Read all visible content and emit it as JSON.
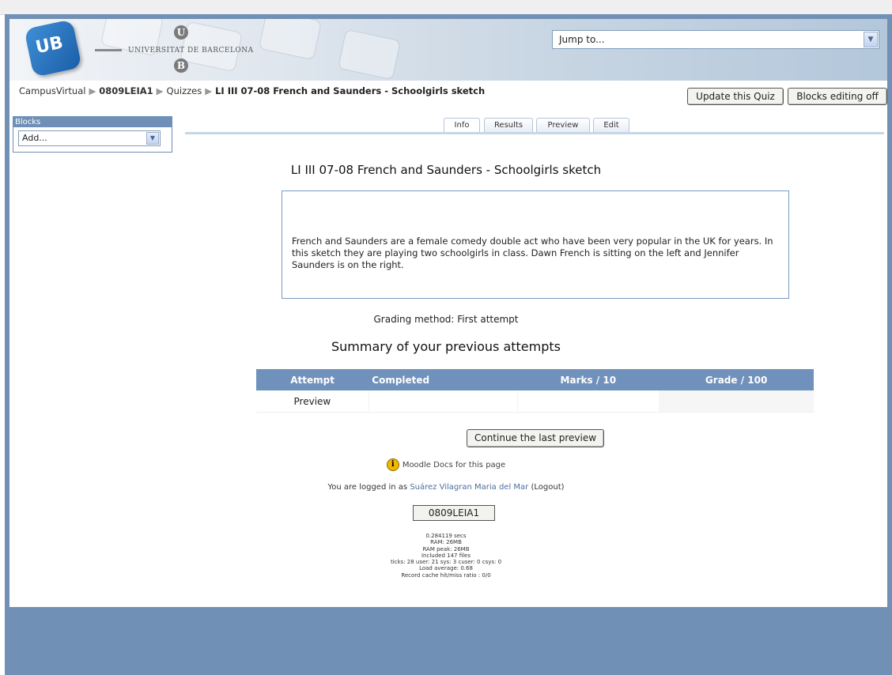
{
  "header": {
    "university": "UNIVERSITAT DE BARCELONA",
    "logo_text": "UB",
    "seal_u": "U",
    "seal_b": "B",
    "jump_label": "Jump to..."
  },
  "breadcrumb": {
    "home": "CampusVirtual",
    "course": "0809LEIA1",
    "section": "Quizzes",
    "current": "LI III 07-08 French and Saunders - Schoolgirls sketch"
  },
  "buttons": {
    "update": "Update this Quiz",
    "blocks_editing": "Blocks editing off",
    "continue": "Continue the last preview"
  },
  "blocks": {
    "header": "Blocks",
    "add_label": "Add..."
  },
  "tabs": [
    "Info",
    "Results",
    "Preview",
    "Edit"
  ],
  "quiz": {
    "title": "LI III 07-08 French and Saunders - Schoolgirls sketch",
    "intro": "French and Saunders are a female comedy double act who have been very popular in the UK for years. In this sketch they are playing two schoolgirls in class. Dawn French is sitting on the left and Jennifer Saunders is on the right.",
    "grading_method": "Grading method: First attempt",
    "summary_title": "Summary of your previous attempts"
  },
  "attempts_table": {
    "headers": [
      "Attempt",
      "Completed",
      "Marks / 10",
      "Grade / 100"
    ],
    "rows": [
      [
        "Preview",
        "",
        "",
        ""
      ]
    ]
  },
  "footer": {
    "docs_link": "Moodle Docs for this page",
    "logged_prefix": "You are logged in as",
    "user_name": "Suárez Vilagran Maria del Mar",
    "logout": "(Logout)",
    "course_button": "0809LEIA1",
    "perf_lines": [
      "0.284119 secs",
      "RAM: 26MB",
      "RAM peak: 26MB",
      "Included 147 files",
      "ticks: 28 user: 21 sys: 3 cuser: 0 csys: 0",
      "Load average: 0.68",
      "Record cache hit/miss ratio : 0/0"
    ]
  },
  "colors": {
    "frame": "#7090b5",
    "table_header": "#6f91bb",
    "link": "#4a6fa0"
  }
}
